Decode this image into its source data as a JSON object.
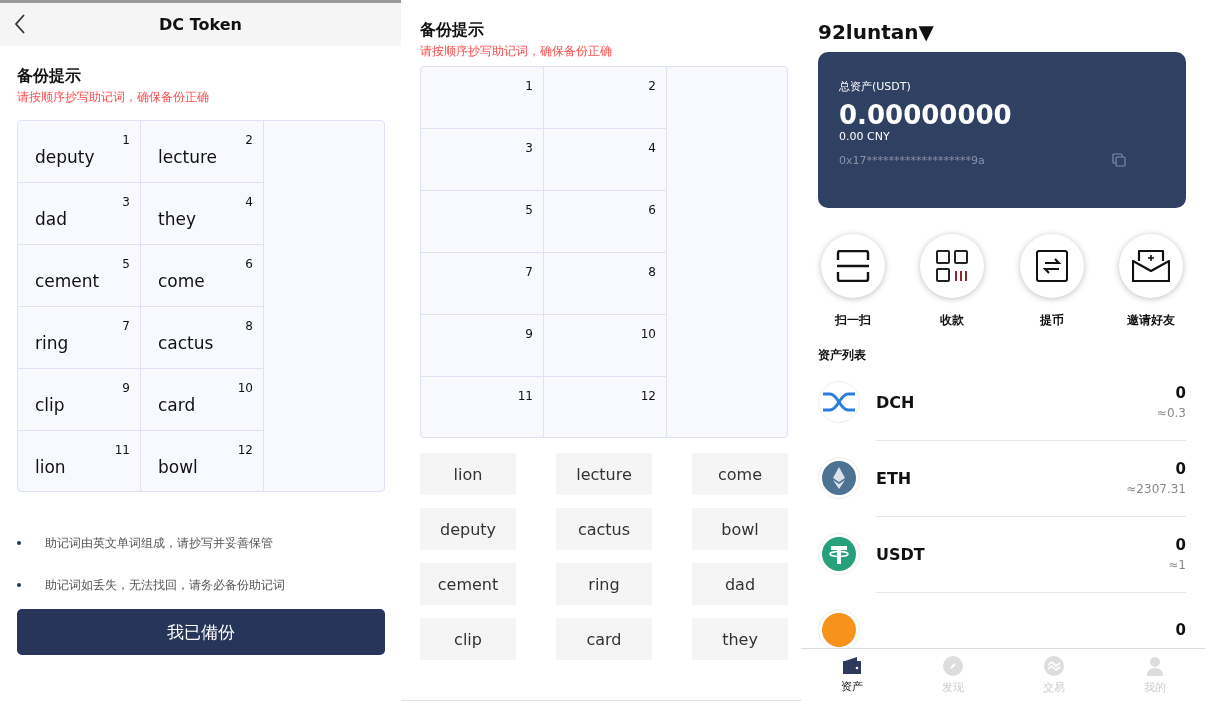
{
  "backup_screen": {
    "header": {
      "title": "DC Token"
    },
    "heading": "备份提示",
    "hint": "请按顺序抄写助记词，确保备份正确",
    "words": [
      {
        "number": "1",
        "word": "deputy"
      },
      {
        "number": "2",
        "word": "lecture"
      },
      {
        "number": "3",
        "word": "dad"
      },
      {
        "number": "4",
        "word": "they"
      },
      {
        "number": "5",
        "word": "cement"
      },
      {
        "number": "6",
        "word": "come"
      },
      {
        "number": "7",
        "word": "ring"
      },
      {
        "number": "8",
        "word": "cactus"
      },
      {
        "number": "9",
        "word": "clip"
      },
      {
        "number": "10",
        "word": "card"
      },
      {
        "number": "11",
        "word": "lion"
      },
      {
        "number": "12",
        "word": "bowl"
      }
    ],
    "notes": [
      "助记词由英文单词组成，请抄写并妥善保管",
      "助记词如丢失，无法找回，请务必备份助记词"
    ],
    "confirm_button": "我已備份"
  },
  "verify_screen": {
    "heading": "备份提示",
    "hint": "请按顺序抄写助记词，确保备份正确",
    "slots": [
      "1",
      "2",
      "3",
      "4",
      "5",
      "6",
      "7",
      "8",
      "9",
      "10",
      "11",
      "12"
    ],
    "choices": [
      "lion",
      "lecture",
      "come",
      "deputy",
      "cactus",
      "bowl",
      "cement",
      "ring",
      "dad",
      "clip",
      "card",
      "they"
    ]
  },
  "wallet_screen": {
    "wallet_name": "92luntan▼",
    "balance_card": {
      "label": "总资产(USDT)",
      "total": "0.00000000",
      "fiat": "0.00 CNY",
      "address": "0x17*******************9a"
    },
    "actions": [
      {
        "kind": "scan",
        "label": "扫一扫"
      },
      {
        "kind": "receive",
        "label": "收款"
      },
      {
        "kind": "withdraw",
        "label": "提币"
      },
      {
        "kind": "invite",
        "label": "邀请好友"
      }
    ],
    "assets_heading": "资产列表",
    "assets": [
      {
        "kind": "dch",
        "name": "DCH",
        "amount": "0",
        "value": "≈0.3"
      },
      {
        "kind": "eth",
        "name": "ETH",
        "amount": "0",
        "value": "≈2307.31"
      },
      {
        "kind": "usdt",
        "name": "USDT",
        "amount": "0",
        "value": "≈1"
      },
      {
        "kind": "btc",
        "amount": "0"
      }
    ],
    "tab_bar": [
      {
        "kind": "wallet",
        "label": "资产",
        "selected": true
      },
      {
        "kind": "compass",
        "label": "发现",
        "selected": false
      },
      {
        "kind": "exchange",
        "label": "交易",
        "selected": false
      },
      {
        "kind": "user",
        "label": "我的",
        "selected": false
      }
    ]
  }
}
